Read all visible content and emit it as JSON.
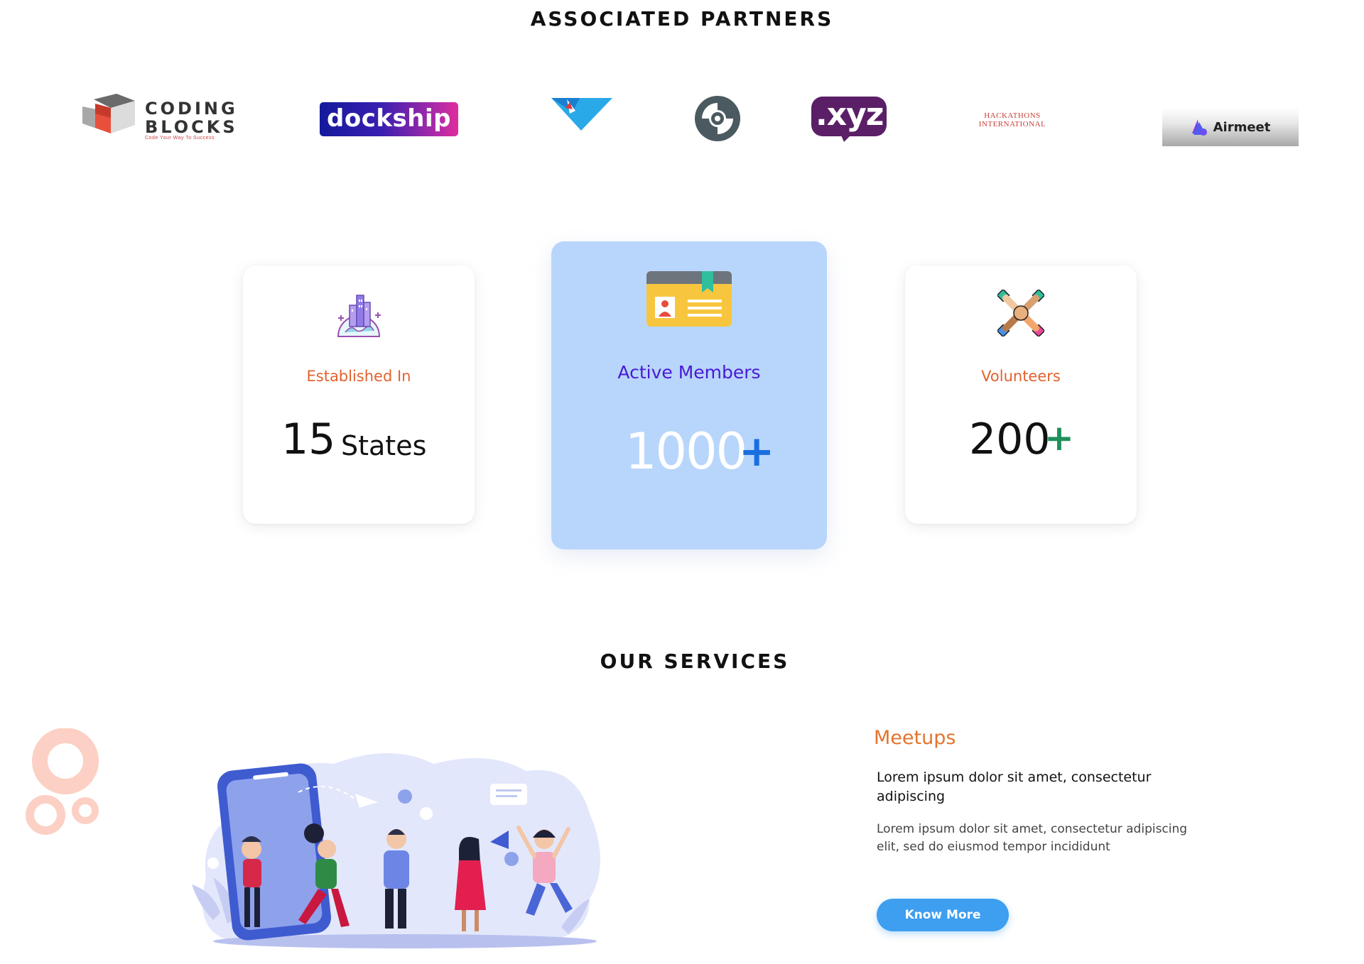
{
  "partners": {
    "title": "ASSOCIATED PARTNERS",
    "logos": {
      "coding_blocks": {
        "line1": "CODING",
        "line2": "BLOCKS",
        "tagline": "Code Your Way To Success"
      },
      "dockship": {
        "text": "dockship"
      },
      "xyz": {
        "text": ".xyz"
      },
      "hackathons": {
        "line1": "HACKATHONS",
        "line2": "INTERNATIONAL"
      },
      "airmeet": {
        "text": "Airmeet"
      }
    }
  },
  "stats": {
    "established": {
      "label": "Established In",
      "value": "15",
      "unit": "States",
      "icon": "globe-city-icon"
    },
    "members": {
      "label": "Active Members",
      "value": "1000",
      "suffix": "+",
      "icon": "id-card-icon"
    },
    "volunteers": {
      "label": "Volunteers",
      "value": "200",
      "suffix": "+",
      "icon": "joined-hands-icon"
    }
  },
  "services": {
    "title": "OUR SERVICES",
    "item": {
      "title": "Meetups",
      "subtitle": "Lorem ipsum dolor sit amet, consectetur  adipiscing",
      "body": "Lorem ipsum dolor sit amet, consectetur adipiscing elit, sed do eiusmod tempor incididunt",
      "button": "Know More"
    }
  },
  "colors": {
    "accent_orange": "#e3612e",
    "members_card": "#b8d6fb",
    "members_label": "#4a19d6",
    "button": "#3e9ef0",
    "volunteer_plus": "#1f8f5a"
  }
}
